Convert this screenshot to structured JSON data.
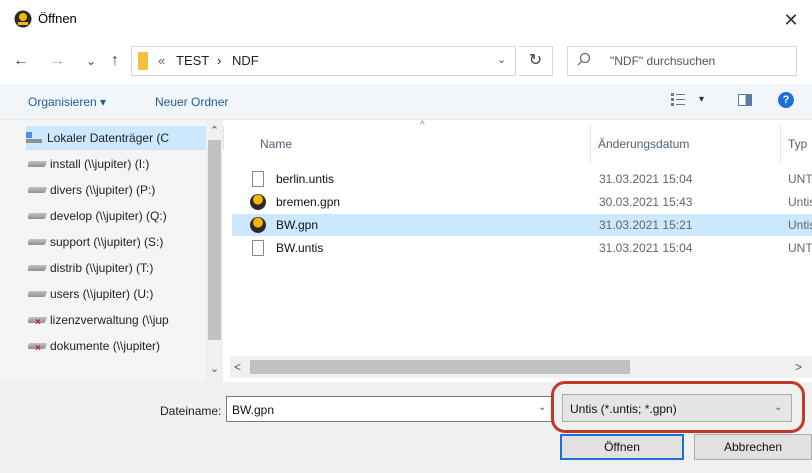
{
  "window": {
    "title": "Öffnen",
    "close_glyph": "✕"
  },
  "nav": {
    "back": "←",
    "forward": "→",
    "recent": "⌄",
    "up": "↑"
  },
  "address": {
    "overflow": "«",
    "crumbs": [
      "TEST",
      "NDF"
    ],
    "separator": "›",
    "dropdown": "⌄",
    "refresh": "↻"
  },
  "search": {
    "placeholder": "\"NDF\" durchsuchen",
    "icon": "search-icon"
  },
  "toolbar": {
    "organize_label": "Organisieren ▾",
    "new_folder_label": "Neuer Ordner",
    "view_caret": "▾",
    "help": "?"
  },
  "sidebar": {
    "items": [
      {
        "label": "Lokaler Datenträger (C",
        "icon": "local-disk-icon",
        "selected": true
      },
      {
        "label": "install (\\\\jupiter) (I:)",
        "icon": "network-drive-icon"
      },
      {
        "label": "divers (\\\\jupiter) (P:)",
        "icon": "network-drive-icon"
      },
      {
        "label": "develop (\\\\jupiter) (Q:)",
        "icon": "network-drive-icon"
      },
      {
        "label": "support (\\\\jupiter) (S:)",
        "icon": "network-drive-icon"
      },
      {
        "label": "distrib (\\\\jupiter) (T:)",
        "icon": "network-drive-icon"
      },
      {
        "label": "users (\\\\jupiter) (U:)",
        "icon": "network-drive-icon"
      },
      {
        "label": "lizenzverwaltung (\\\\jup",
        "icon": "disconnected-drive-icon"
      },
      {
        "label": "dokumente (\\\\jupiter)",
        "icon": "disconnected-drive-icon"
      }
    ],
    "scroll_up": "⌃",
    "scroll_down": "⌄"
  },
  "filelist": {
    "columns": {
      "name": "Name",
      "date": "Änderungsdatum",
      "type": "Typ"
    },
    "sort_arrow": "^",
    "rows": [
      {
        "name": "berlin.untis",
        "date": "31.03.2021 15:04",
        "type": "UNTIS",
        "icon": "document-icon"
      },
      {
        "name": "bremen.gpn",
        "date": "30.03.2021 15:43",
        "type": "Untis",
        "icon": "gpn-file-icon"
      },
      {
        "name": "BW.gpn",
        "date": "31.03.2021 15:21",
        "type": "Untis",
        "icon": "gpn-file-icon",
        "selected": true
      },
      {
        "name": "BW.untis",
        "date": "31.03.2021 15:04",
        "type": "UNTIS",
        "icon": "document-icon"
      }
    ],
    "hscroll_left": "<",
    "hscroll_right": ">"
  },
  "footer": {
    "filename_label": "Dateiname:",
    "filename_value": "BW.gpn",
    "filename_caret": "⌄",
    "filter_value": "Untis (*.untis; *.gpn)",
    "filter_caret": "⌄",
    "open_label": "Öffnen",
    "cancel_label": "Abbrechen"
  },
  "colors": {
    "accent": "#1e6fd9",
    "selection": "#cce8ff",
    "highlight_ring": "#c0392b"
  }
}
